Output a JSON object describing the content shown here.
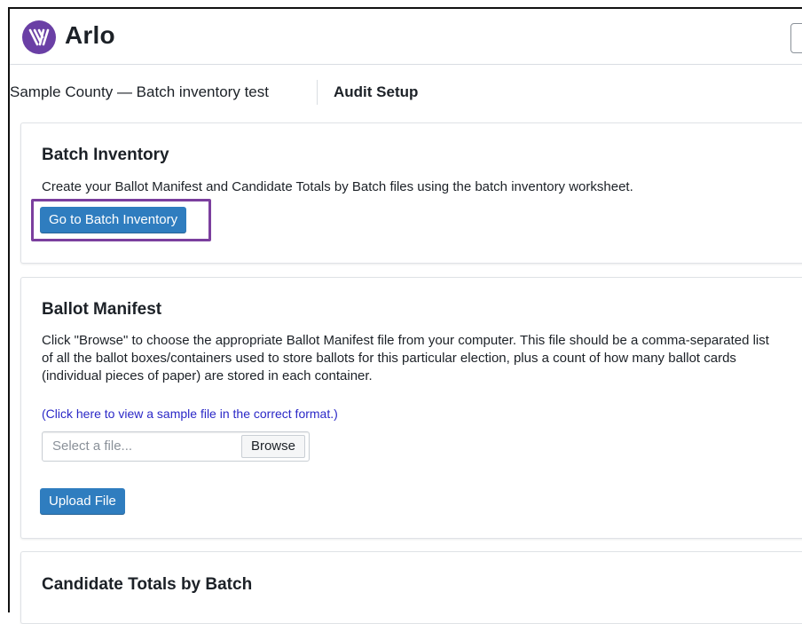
{
  "app": {
    "name": "Arlo",
    "logo_icon": "arlo-logo-icon"
  },
  "subnav": {
    "breadcrumb": "Sample County — Batch inventory test",
    "active_tab": "Audit Setup"
  },
  "batch_inventory": {
    "title": "Batch Inventory",
    "description": "Create your Ballot Manifest and Candidate Totals by Batch files using the batch inventory worksheet.",
    "button_label": "Go to Batch Inventory"
  },
  "ballot_manifest": {
    "title": "Ballot Manifest",
    "description": "Click \"Browse\" to choose the appropriate Ballot Manifest file from your computer. This file should be a comma-separated list of all the ballot boxes/containers used to store ballots for this particular election, plus a count of how many ballot cards (individual pieces of paper) are stored in each container.",
    "sample_link": "(Click here to view a sample file in the correct format.)",
    "file_placeholder": "Select a file...",
    "browse_label": "Browse",
    "upload_label": "Upload File"
  },
  "candidate_totals": {
    "title": "Candidate Totals by Batch"
  },
  "colors": {
    "brand": "#6a3fa5",
    "primary_button": "#2f7dbf",
    "highlight_outline": "#7b3f9e",
    "link": "#2b28c7"
  }
}
